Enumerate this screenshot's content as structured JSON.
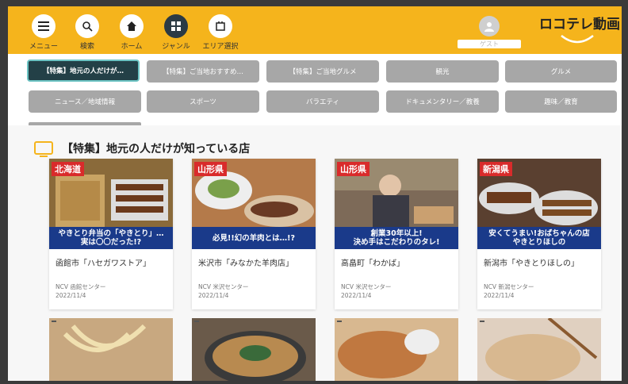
{
  "header": {
    "nav": [
      {
        "label": "メニュー",
        "icon": "hamburger-icon"
      },
      {
        "label": "検索",
        "icon": "search-icon"
      },
      {
        "label": "ホーム",
        "icon": "home-icon"
      },
      {
        "label": "ジャンル",
        "icon": "grid-icon"
      },
      {
        "label": "エリア選択",
        "icon": "frame-icon"
      }
    ],
    "guest_label": "ゲスト",
    "logo_text": "ロコテレ動画"
  },
  "genres": [
    {
      "label": "【特集】地元の人だけが…",
      "active": true
    },
    {
      "label": "【特集】ご当地おすすめ…"
    },
    {
      "label": "【特集】ご当地グルメ"
    },
    {
      "label": "観光"
    },
    {
      "label": "グルメ"
    },
    {
      "label": "ニュース／地域情報"
    },
    {
      "label": "スポーツ"
    },
    {
      "label": "バラエティ"
    },
    {
      "label": "ドキュメンタリー／教養"
    },
    {
      "label": "趣味／教育"
    }
  ],
  "section": {
    "title": "【特集】地元の人だけが知っている店"
  },
  "cards": [
    {
      "badge": "北海道",
      "caption": "やきとり弁当の「やきとり」…\n実は〇〇だった!?",
      "title": "函館市「ハセガワストア」",
      "source": "NCV 函館センター",
      "date": "2022/11/4"
    },
    {
      "badge": "山形県",
      "caption": "必見!!幻の羊肉とは…!?",
      "title": "米沢市「みなかた羊肉店」",
      "source": "NCV 米沢センター",
      "date": "2022/11/4"
    },
    {
      "badge": "山形県",
      "caption": "創業30年以上!\n決め手はこだわりのタレ!",
      "title": "高畠町「わかば」",
      "source": "NCV 米沢センター",
      "date": "2022/11/4"
    },
    {
      "badge": "新潟県",
      "caption": "安くてうまい!おばちゃんの店\nやきとりほしの",
      "title": "新潟市「やきとりほしの」",
      "source": "NCV 新潟センター",
      "date": "2022/11/4"
    }
  ],
  "colors": {
    "header": "#f5b41c",
    "badge": "#d92b2b",
    "caption": "#1a3a8a",
    "active_genre": "#234047"
  }
}
